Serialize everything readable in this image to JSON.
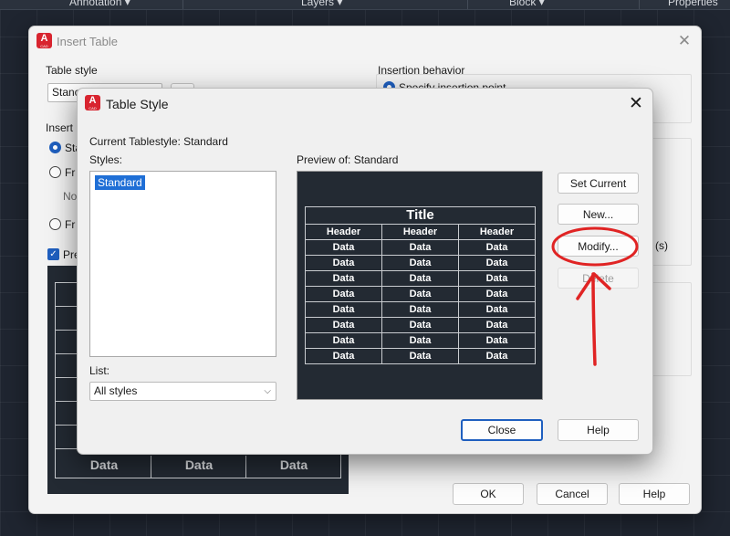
{
  "ribbon": {
    "tabs": [
      "Annotation ▾",
      "Layers ▾",
      "Block ▾",
      "Properties"
    ]
  },
  "insert_table": {
    "title": "Insert Table",
    "table_style_label": "Table style",
    "table_style_value": "Stanc",
    "insert_options_label": "Insert",
    "option_start_empty": "Sta",
    "option_from_data": "Fr",
    "option_from_data_value": "No",
    "option_from_object": "Fr",
    "preview_checkbox_label": "Pre",
    "insertion_behavior_label": "Insertion behavior",
    "insertion_specify_point": "Specify insertion point",
    "rows_suffix": "(s)",
    "preview_bottom_row": [
      "Data",
      "Data",
      "Data"
    ],
    "buttons": {
      "ok": "OK",
      "cancel": "Cancel",
      "help": "Help"
    }
  },
  "table_style": {
    "title": "Table Style",
    "current_tablestyle": "Current Tablestyle: Standard",
    "styles_label": "Styles:",
    "styles": [
      "Standard"
    ],
    "selected_style": "Standard",
    "list_label": "List:",
    "list_value": "All styles",
    "preview_label": "Preview of: Standard",
    "preview": {
      "title": "Title",
      "headers": [
        "Header",
        "Header",
        "Header"
      ],
      "rows": [
        [
          "Data",
          "Data",
          "Data"
        ],
        [
          "Data",
          "Data",
          "Data"
        ],
        [
          "Data",
          "Data",
          "Data"
        ],
        [
          "Data",
          "Data",
          "Data"
        ],
        [
          "Data",
          "Data",
          "Data"
        ],
        [
          "Data",
          "Data",
          "Data"
        ],
        [
          "Data",
          "Data",
          "Data"
        ],
        [
          "Data",
          "Data",
          "Data"
        ]
      ]
    },
    "buttons": {
      "set_current": "Set Current",
      "new": "New...",
      "modify": "Modify...",
      "delete": "Delete",
      "close": "Close",
      "help": "Help"
    }
  },
  "app_icon": {
    "letter": "A",
    "sub": "CAD"
  },
  "colors": {
    "accent": "#1f5fbf",
    "selection": "#1f6fd6",
    "annotation_red": "#e02424",
    "app_icon_red": "#d8242f"
  }
}
